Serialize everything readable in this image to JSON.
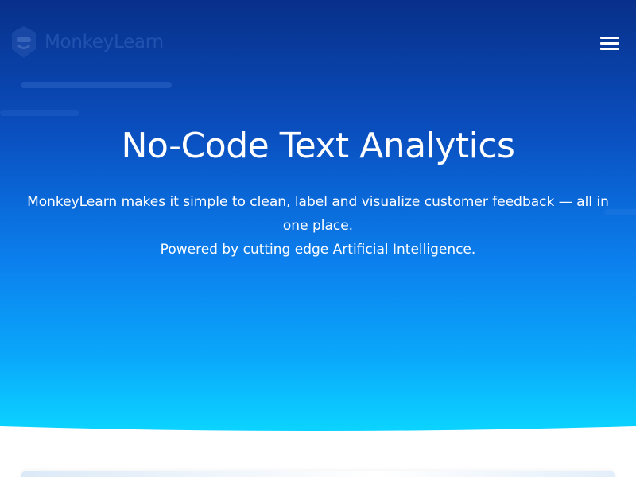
{
  "brand": {
    "name": "MonkeyLearn",
    "logo_icon": "monkey-logo-icon",
    "logo_color": "#3f6fc9"
  },
  "nav": {
    "menu_icon": "hamburger-menu-icon"
  },
  "hero": {
    "title": "No-Code Text Analytics",
    "subtitle_line1": "MonkeyLearn makes it simple to clean, label and visualize customer feedback — all in one place.",
    "subtitle_line2": "Powered by cutting edge Artificial Intelligence.",
    "gradient_top": "#08308a",
    "gradient_bottom": "#0bd3ff",
    "text_color": "#ffffff"
  }
}
